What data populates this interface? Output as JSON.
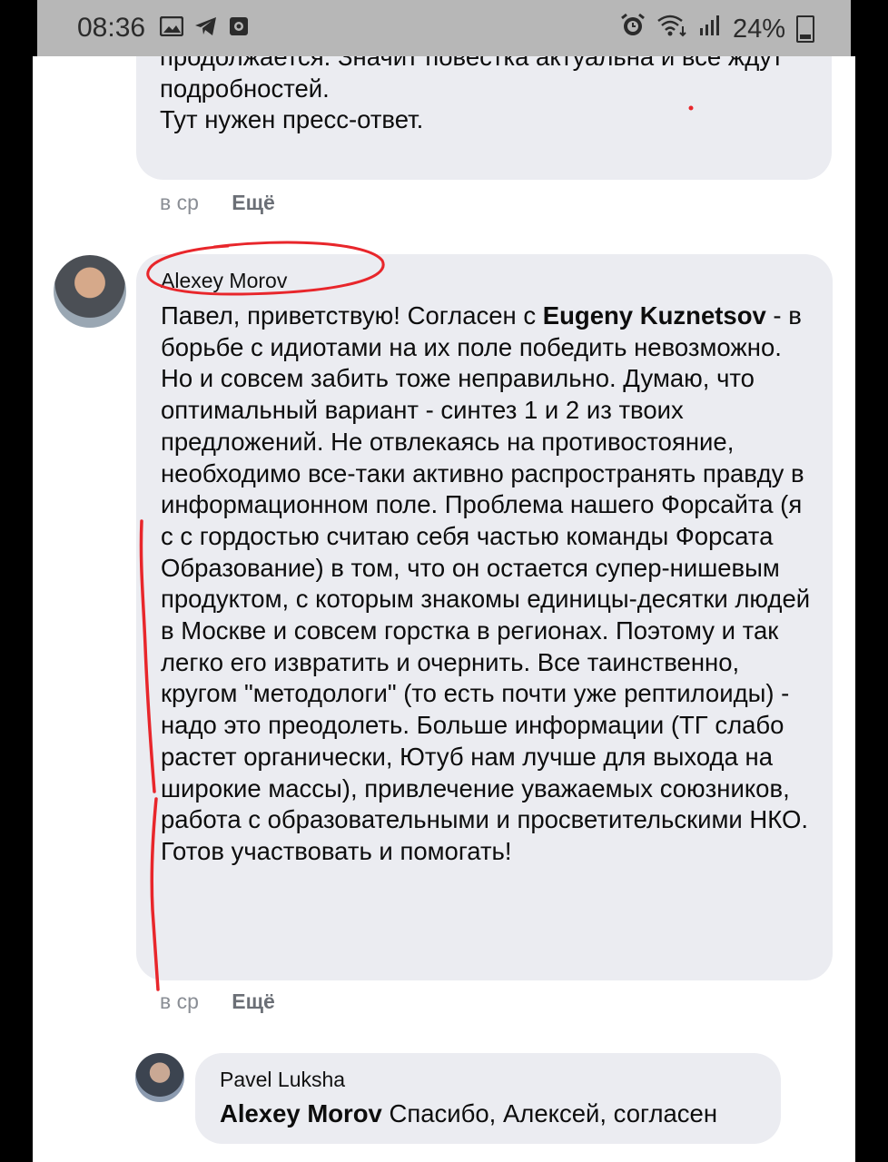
{
  "status_bar": {
    "time": "08:36",
    "battery": "24%",
    "left_icons": [
      "gallery-icon",
      "telegram-icon",
      "record-icon"
    ],
    "right_icons": [
      "alarm-icon",
      "wifi-icon",
      "signal-icon",
      "battery-icon"
    ]
  },
  "comments": [
    {
      "text": "продолжается. Значит повестка актуальна и все ждут подробностей.\nТут нужен пресс-ответ.",
      "time": "в ср",
      "more": "Ещё"
    },
    {
      "author": "Alexey Morov",
      "mention": "Eugeny Kuznetsov",
      "text_before": "Павел, приветствую! Согласен с ",
      "text_after": " - в борьбе с идиотами на их поле победить невозможно. Но и совсем забить тоже неправильно. Думаю, что оптимальный вариант - синтез 1 и 2 из твоих предложений. Не отвлекаясь на противостояние, необходимо все-таки активно распространять правду в информационном поле. Проблема нашего Форсайта (я с с гордостью считаю себя частью команды Форсата Образование) в том, что он остается супер-нишевым продуктом, с которым знакомы единицы-десятки людей в Москве и совсем горстка в регионах. Поэтому и так легко его извратить и очернить. Все таинственно, кругом \"методологи\" (то есть почти уже рептилоиды) - надо это преодолеть. Больше информации (ТГ слабо растет органически, Ютуб нам лучше для выхода на широкие массы), привлечение уважаемых союзников, работа с образовательными и просветительскими НКО. Готов участвовать и помогать!",
      "time": "в ср",
      "more": "Ещё"
    },
    {
      "author": "Pavel Luksha",
      "mention": "Alexey Morov",
      "text_after": " Спасибо, Алексей, согласен"
    }
  ],
  "colors": {
    "bubble": "#ebecf1",
    "annotation": "#e8262b",
    "status_bar": "#b7b7b7"
  }
}
